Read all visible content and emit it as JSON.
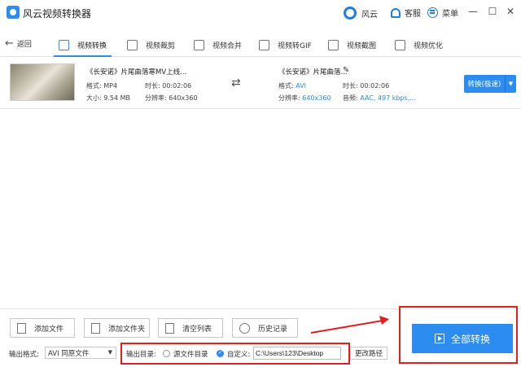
{
  "app": {
    "title": "风云视频转换器"
  },
  "titlebar": {
    "fengyun_label": "风云",
    "service_label": "客服",
    "menu_label": "菜单",
    "minimize": "—",
    "maximize": "☐",
    "close": "✕"
  },
  "toolbar": {
    "back_label": "返回",
    "tabs": [
      {
        "label": "视频转换",
        "icon": "video-convert-icon",
        "active": true
      },
      {
        "label": "视频裁剪",
        "icon": "video-crop-icon",
        "active": false
      },
      {
        "label": "视频合并",
        "icon": "video-merge-icon",
        "active": false
      },
      {
        "label": "视频转GIF",
        "icon": "gif-icon",
        "active": false
      },
      {
        "label": "视频截图",
        "icon": "screenshot-icon",
        "active": false
      },
      {
        "label": "视频优化",
        "icon": "optimize-icon",
        "active": false
      }
    ]
  },
  "file": {
    "source": {
      "name": "《长安诺》片尾曲落寒MV上线...",
      "format_label": "格式:",
      "format": "MP4",
      "duration_label": "时长:",
      "duration": "00:02:06",
      "size_label": "大小:",
      "size": "9.54 MB",
      "resolution_label": "分辨率:",
      "resolution": "640x360"
    },
    "target": {
      "name": "《长安诺》片尾曲落...",
      "format_label": "格式:",
      "format": "AVI",
      "duration_label": "时长:",
      "duration": "00:02:06",
      "resolution_label": "分辨率:",
      "resolution": "640x360",
      "audio_label": "音频:",
      "audio": "AAC, 497 kbps,..."
    },
    "convert_label": "转换(极速)",
    "convert_drop": "▼"
  },
  "bottom": {
    "add_file": "添加文件",
    "add_folder": "添加文件夹",
    "clear_list": "清空列表",
    "history": "历史记录",
    "output_format_label": "输出格式:",
    "output_format_value": "AVI 同原文件",
    "output_dir_label": "输出目录:",
    "source_folder_label": "源文件目录",
    "custom_label": "自定义:",
    "custom_path": "C:\\Users\\123\\Desktop",
    "change_path": "更改路径",
    "convert_all": "全部转换"
  },
  "colors": {
    "accent": "#2d8cf0",
    "highlight": "#e02020"
  }
}
